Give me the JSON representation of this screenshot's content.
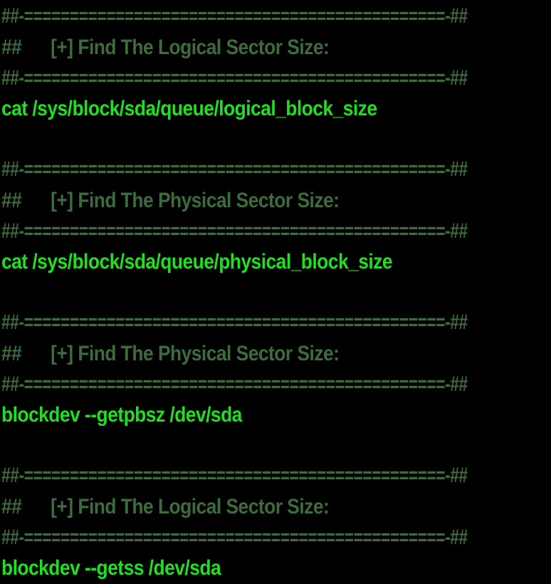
{
  "divider": "##-==============================================-##",
  "blocks": [
    {
      "heading": "##      [+] Find The Logical Sector Size:",
      "command": "cat /sys/block/sda/queue/logical_block_size"
    },
    {
      "heading": "##      [+] Find The Physical Sector Size:",
      "command": "cat /sys/block/sda/queue/physical_block_size"
    },
    {
      "heading": "##      [+] Find The Physical Sector Size:",
      "command": "blockdev --getpbsz /dev/sda"
    },
    {
      "heading": "##      [+] Find The Logical Sector Size:",
      "command": "blockdev --getss /dev/sda"
    }
  ],
  "colors": {
    "background": "#000000",
    "comment": "#3d6b3d",
    "command": "#1fe01f"
  }
}
